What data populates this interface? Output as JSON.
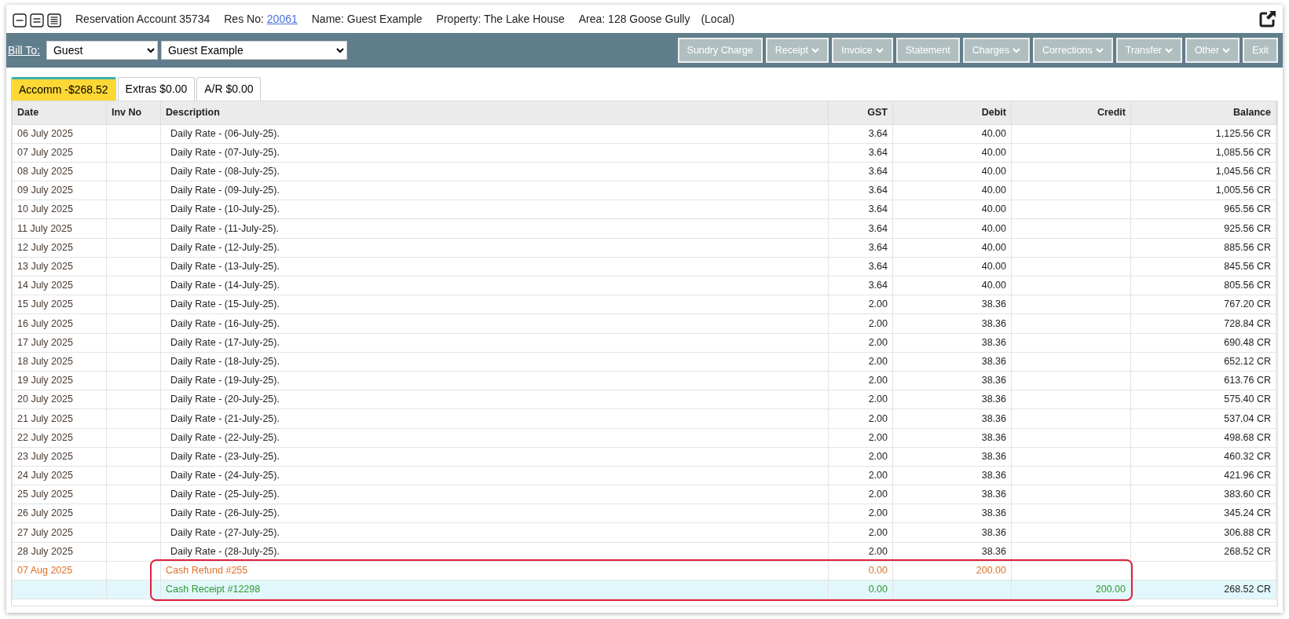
{
  "header": {
    "title": "Reservation Account 35734",
    "res_label": "Res No:",
    "res_no": "20061",
    "name": "Name: Guest Example",
    "property": "Property: The Lake House",
    "area": "Area: 128 Goose Gully",
    "location": "(Local)"
  },
  "toolbar": {
    "bill_to_label": "Bill To:",
    "bill_to": "Guest",
    "bill_to_name": "Guest Example",
    "buttons": [
      {
        "label": "Sundry Charge",
        "dropdown": false
      },
      {
        "label": "Receipt",
        "dropdown": true
      },
      {
        "label": "Invoice",
        "dropdown": true
      },
      {
        "label": "Statement",
        "dropdown": false
      },
      {
        "label": "Charges",
        "dropdown": true
      },
      {
        "label": "Corrections",
        "dropdown": true
      },
      {
        "label": "Transfer",
        "dropdown": true
      },
      {
        "label": "Other",
        "dropdown": true
      },
      {
        "label": "Exit",
        "dropdown": false
      }
    ]
  },
  "tabs": [
    {
      "label": "Accomm -$268.52",
      "selected": true
    },
    {
      "label": "Extras $0.00",
      "selected": false
    },
    {
      "label": "A/R $0.00",
      "selected": false
    }
  ],
  "table": {
    "columns": [
      "Date",
      "Inv No",
      "Description",
      "GST",
      "Debit",
      "Credit",
      "Balance"
    ],
    "rows": [
      {
        "kind": "charge",
        "date": "06 July 2025",
        "description": "Daily Rate  - (06-July-25).",
        "gst": "3.64",
        "debit": "40.00",
        "balance": "1,125.56 CR"
      },
      {
        "kind": "charge",
        "date": "07 July 2025",
        "description": "Daily Rate  - (07-July-25).",
        "gst": "3.64",
        "debit": "40.00",
        "balance": "1,085.56 CR"
      },
      {
        "kind": "charge",
        "date": "08 July 2025",
        "description": "Daily Rate  - (08-July-25).",
        "gst": "3.64",
        "debit": "40.00",
        "balance": "1,045.56 CR"
      },
      {
        "kind": "charge",
        "date": "09 July 2025",
        "description": "Daily Rate  - (09-July-25).",
        "gst": "3.64",
        "debit": "40.00",
        "balance": "1,005.56 CR"
      },
      {
        "kind": "charge",
        "date": "10 July 2025",
        "description": "Daily Rate  - (10-July-25).",
        "gst": "3.64",
        "debit": "40.00",
        "balance": "965.56 CR"
      },
      {
        "kind": "charge",
        "date": "11 July 2025",
        "description": "Daily Rate  - (11-July-25).",
        "gst": "3.64",
        "debit": "40.00",
        "balance": "925.56 CR"
      },
      {
        "kind": "charge",
        "date": "12 July 2025",
        "description": "Daily Rate  - (12-July-25).",
        "gst": "3.64",
        "debit": "40.00",
        "balance": "885.56 CR"
      },
      {
        "kind": "charge",
        "date": "13 July 2025",
        "description": "Daily Rate  - (13-July-25).",
        "gst": "3.64",
        "debit": "40.00",
        "balance": "845.56 CR"
      },
      {
        "kind": "charge",
        "date": "14 July 2025",
        "description": "Daily Rate  - (14-July-25).",
        "gst": "3.64",
        "debit": "40.00",
        "balance": "805.56 CR"
      },
      {
        "kind": "charge",
        "date": "15 July 2025",
        "description": "Daily Rate  - (15-July-25).",
        "gst": "2.00",
        "debit": "38.36",
        "balance": "767.20 CR"
      },
      {
        "kind": "charge",
        "date": "16 July 2025",
        "description": "Daily Rate  - (16-July-25).",
        "gst": "2.00",
        "debit": "38.36",
        "balance": "728.84 CR"
      },
      {
        "kind": "charge",
        "date": "17 July 2025",
        "description": "Daily Rate  - (17-July-25).",
        "gst": "2.00",
        "debit": "38.36",
        "balance": "690.48 CR"
      },
      {
        "kind": "charge",
        "date": "18 July 2025",
        "description": "Daily Rate  - (18-July-25).",
        "gst": "2.00",
        "debit": "38.36",
        "balance": "652.12 CR"
      },
      {
        "kind": "charge",
        "date": "19 July 2025",
        "description": "Daily Rate  - (19-July-25).",
        "gst": "2.00",
        "debit": "38.36",
        "balance": "613.76 CR"
      },
      {
        "kind": "charge",
        "date": "20 July 2025",
        "description": "Daily Rate  - (20-July-25).",
        "gst": "2.00",
        "debit": "38.36",
        "balance": "575.40 CR"
      },
      {
        "kind": "charge",
        "date": "21 July 2025",
        "description": "Daily Rate  - (21-July-25).",
        "gst": "2.00",
        "debit": "38.36",
        "balance": "537.04 CR"
      },
      {
        "kind": "charge",
        "date": "22 July 2025",
        "description": "Daily Rate  - (22-July-25).",
        "gst": "2.00",
        "debit": "38.36",
        "balance": "498.68 CR"
      },
      {
        "kind": "charge",
        "date": "23 July 2025",
        "description": "Daily Rate  - (23-July-25).",
        "gst": "2.00",
        "debit": "38.36",
        "balance": "460.32 CR"
      },
      {
        "kind": "charge",
        "date": "24 July 2025",
        "description": "Daily Rate  - (24-July-25).",
        "gst": "2.00",
        "debit": "38.36",
        "balance": "421.96 CR"
      },
      {
        "kind": "charge",
        "date": "25 July 2025",
        "description": "Daily Rate  - (25-July-25).",
        "gst": "2.00",
        "debit": "38.36",
        "balance": "383.60 CR"
      },
      {
        "kind": "charge",
        "date": "26 July 2025",
        "description": "Daily Rate  - (26-July-25).",
        "gst": "2.00",
        "debit": "38.36",
        "balance": "345.24 CR"
      },
      {
        "kind": "charge",
        "date": "27 July 2025",
        "description": "Daily Rate  - (27-July-25).",
        "gst": "2.00",
        "debit": "38.36",
        "balance": "306.88 CR"
      },
      {
        "kind": "charge",
        "date": "28 July 2025",
        "description": "Daily Rate  - (28-July-25).",
        "gst": "2.00",
        "debit": "38.36",
        "balance": "268.52 CR"
      },
      {
        "kind": "refund",
        "date": "07 Aug 2025",
        "description": "Cash Refund #255",
        "gst": "0.00",
        "debit": "200.00",
        "annotated": true
      },
      {
        "kind": "receipt",
        "description": "Cash Receipt #12298",
        "gst": "0.00",
        "credit": "200.00",
        "balance": "268.52 CR",
        "annotated": true
      }
    ]
  }
}
